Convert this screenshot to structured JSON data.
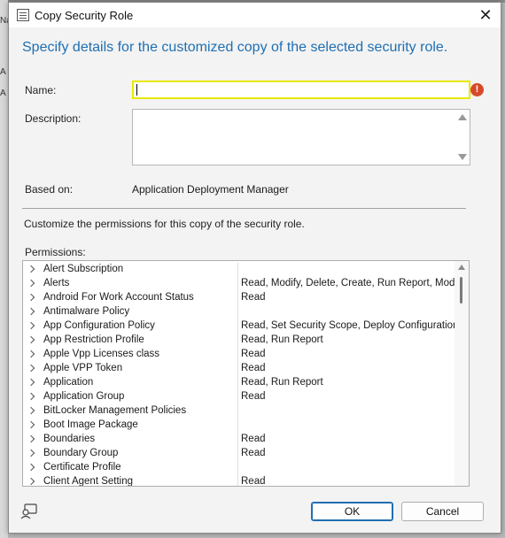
{
  "background": {
    "rows": [
      "Na",
      "A",
      "A"
    ]
  },
  "dialog": {
    "title": "Copy Security Role",
    "close_glyph": "✕",
    "heading": "Specify details for the customized copy of the selected security role.",
    "name_label": "Name:",
    "name_value": "",
    "error_glyph": "!",
    "description_label": "Description:",
    "based_on_label": "Based on:",
    "based_on_value": "Application Deployment Manager",
    "customize_text": "Customize the permissions for this copy of the security role.",
    "permissions_label": "Permissions:",
    "ok_label": "OK",
    "cancel_label": "Cancel"
  },
  "permissions": [
    {
      "name": "Alert Subscription",
      "value": ""
    },
    {
      "name": "Alerts",
      "value": "Read, Modify, Delete, Create, Run Report, Modify F"
    },
    {
      "name": "Android For Work Account Status",
      "value": "Read"
    },
    {
      "name": "Antimalware Policy",
      "value": ""
    },
    {
      "name": "App Configuration Policy",
      "value": "Read, Set Security Scope, Deploy Configuration Ite"
    },
    {
      "name": "App Restriction Profile",
      "value": "Read, Run Report"
    },
    {
      "name": "Apple Vpp Licenses class",
      "value": "Read"
    },
    {
      "name": "Apple VPP Token",
      "value": "Read"
    },
    {
      "name": "Application",
      "value": "Read, Run Report"
    },
    {
      "name": "Application Group",
      "value": "Read"
    },
    {
      "name": "BitLocker Management Policies",
      "value": ""
    },
    {
      "name": "Boot Image Package",
      "value": ""
    },
    {
      "name": "Boundaries",
      "value": "Read"
    },
    {
      "name": "Boundary Group",
      "value": "Read"
    },
    {
      "name": "Certificate Profile",
      "value": ""
    },
    {
      "name": "Client Agent Setting",
      "value": "Read"
    }
  ],
  "colors": {
    "heading": "#1f6fb2",
    "error": "#d54a2a",
    "name_border": "#e8e800"
  },
  "icons": {
    "title": "dialog-window-icon",
    "help": "help-chat-icon",
    "error": "error-icon"
  }
}
